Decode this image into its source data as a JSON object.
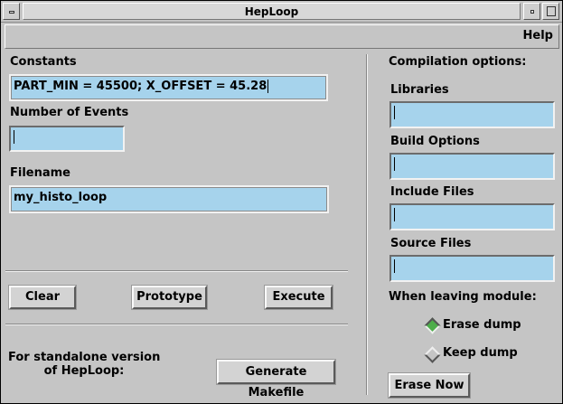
{
  "window": {
    "title": "HepLoop"
  },
  "menubar": {
    "help": "Help"
  },
  "constants": {
    "label": "Constants",
    "value": "PART_MIN = 45500; X_OFFSET = 45.28"
  },
  "events": {
    "label": "Number of Events",
    "value": ""
  },
  "filename": {
    "label": "Filename",
    "value": "my_histo_loop"
  },
  "buttons": {
    "clear": "Clear",
    "prototype": "Prototype",
    "execute": "Execute",
    "generate_makefile": "Generate Makefile",
    "erase_now": "Erase Now"
  },
  "standalone": {
    "line1": "For standalone version",
    "line2": "of HepLoop:"
  },
  "compilation": {
    "title": "Compilation options:",
    "libraries": {
      "label": "Libraries",
      "value": ""
    },
    "build_options": {
      "label": "Build Options",
      "value": ""
    },
    "include_files": {
      "label": "Include Files",
      "value": ""
    },
    "source_files": {
      "label": "Source Files",
      "value": ""
    }
  },
  "leaving": {
    "title": "When leaving module:",
    "options": [
      {
        "label": "Erase dump",
        "selected": true
      },
      {
        "label": "Keep dump",
        "selected": false
      }
    ]
  },
  "colors": {
    "background": "#c5c5c5",
    "field": "#a6d3ec",
    "radio_selected": "#4dae4a"
  }
}
